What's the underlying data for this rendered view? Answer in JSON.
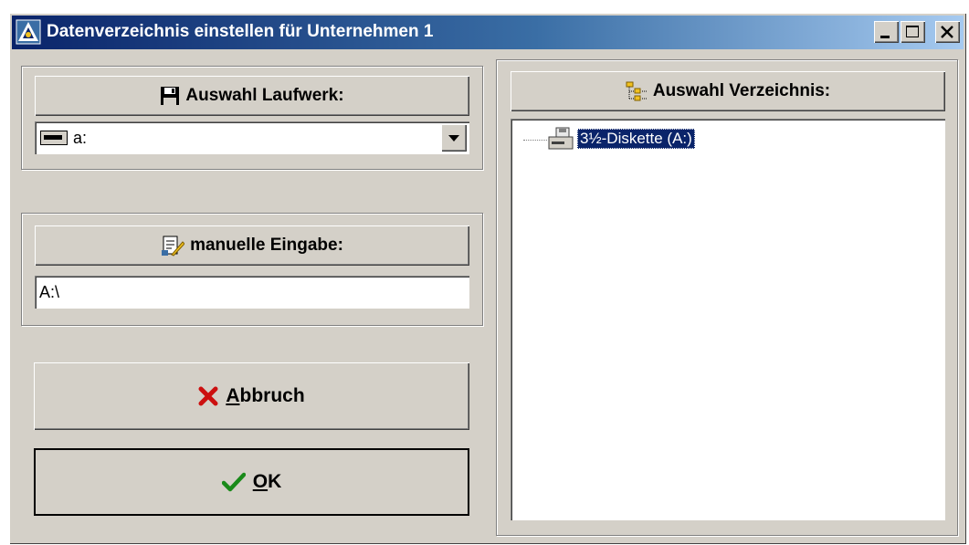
{
  "window": {
    "title": "Datenverzeichnis einstellen für Unternehmen 1"
  },
  "drive_panel": {
    "header_label": "Auswahl Laufwerk:",
    "header_icon": "floppy-disk-icon",
    "selected_drive": "a:",
    "drive_icon": "drive-icon"
  },
  "manual_panel": {
    "header_label": "manuelle Eingabe:",
    "header_icon": "document-edit-icon",
    "path_value": "A:\\"
  },
  "buttons": {
    "cancel_label": "Abbruch",
    "cancel_icon": "red-x-icon",
    "ok_label": "OK",
    "ok_icon": "green-checkmark-icon"
  },
  "directory_panel": {
    "header_label": "Auswahl Verzeichnis:",
    "header_icon": "tree-view-icon",
    "tree_items": [
      {
        "label": "3½-Diskette (A:)",
        "icon": "floppy-drive-icon",
        "selected": true
      }
    ]
  },
  "colors": {
    "title_bar_start": "#0a246a",
    "title_bar_end": "#a6caf0",
    "dialog_face": "#d4d0c8",
    "selection": "#0a246a"
  }
}
